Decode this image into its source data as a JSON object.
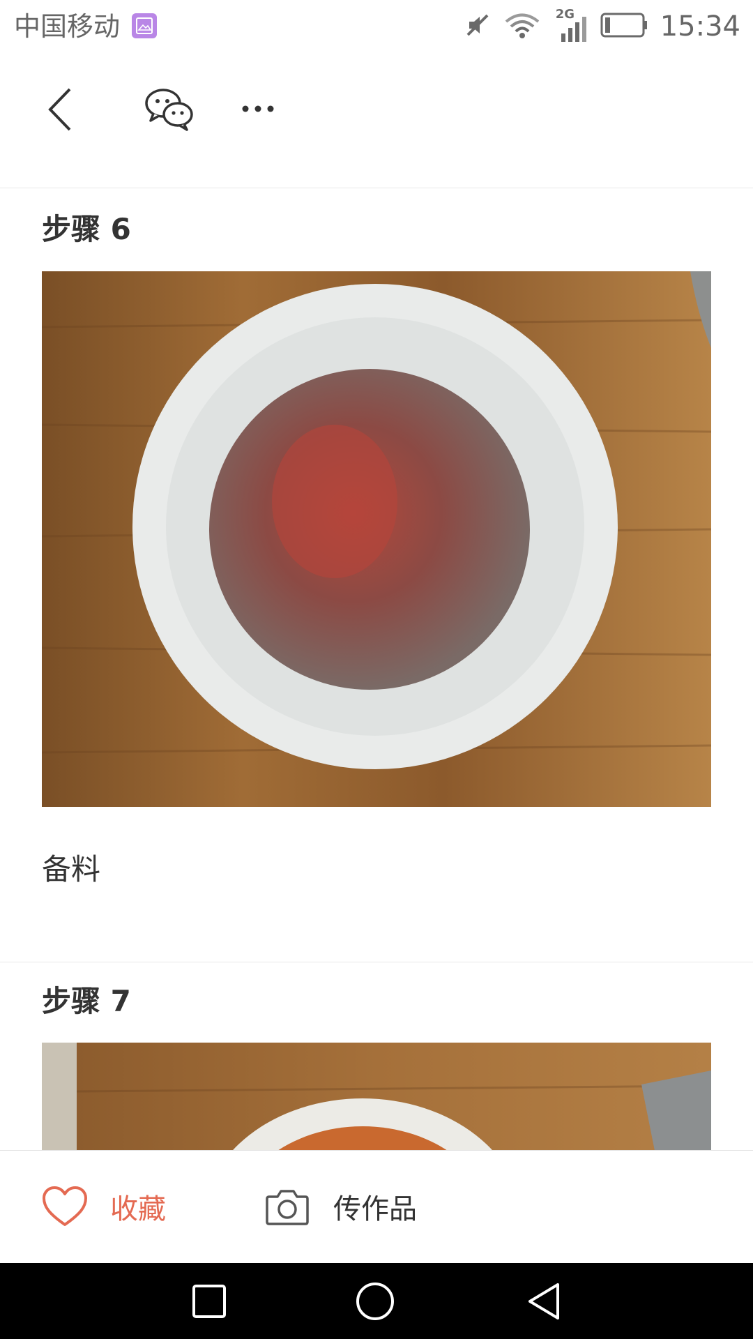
{
  "status_bar": {
    "carrier": "中国移动",
    "network_type": "2G",
    "time": "15:34",
    "icons": [
      "gallery-icon",
      "mute-icon",
      "wifi-icon",
      "signal-icon",
      "battery-icon"
    ]
  },
  "header": {
    "icons": [
      "back-arrow-icon",
      "wechat-icon",
      "more-icon"
    ]
  },
  "steps": [
    {
      "title": "步骤 6",
      "description": "备料"
    },
    {
      "title": "步骤 7",
      "description": ""
    }
  ],
  "action_bar": {
    "favorite_label": "收藏",
    "upload_label": "传作品",
    "accent_color": "#e46a52"
  },
  "system_nav": {
    "icons": [
      "recent-apps-icon",
      "home-icon",
      "back-triangle-icon"
    ]
  }
}
